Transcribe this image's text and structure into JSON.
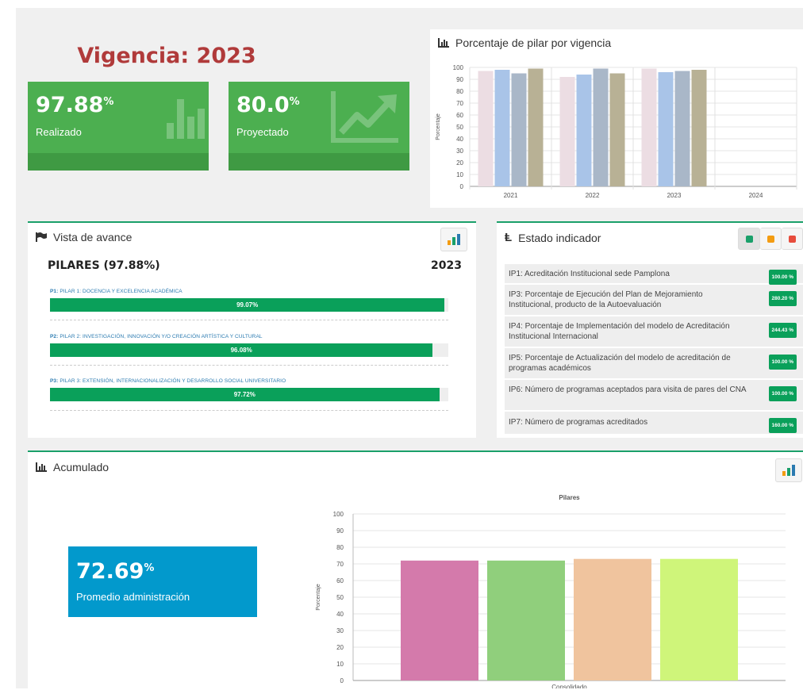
{
  "vigencia_title": "Vigencia: 2023",
  "kpis": [
    {
      "value": "97.88",
      "unit": "%",
      "label": "Realizado",
      "icon": "bar-chart-icon"
    },
    {
      "value": "80.0",
      "unit": "%",
      "label": "Proyectado",
      "icon": "trend-up-icon"
    }
  ],
  "pilar_chart": {
    "title": "Porcentaje de pilar por vigencia",
    "chart_data": {
      "type": "bar",
      "categories": [
        "2021",
        "2022",
        "2023",
        "2024"
      ],
      "series": [
        {
          "values": [
            97,
            92,
            99,
            null
          ],
          "color": "#ecdde3"
        },
        {
          "values": [
            98,
            94,
            96,
            null
          ],
          "color": "#a9c4e8"
        },
        {
          "values": [
            95,
            99,
            97,
            null
          ],
          "color": "#a9b7c8"
        },
        {
          "values": [
            99,
            95,
            98,
            null
          ],
          "color": "#b8b195"
        }
      ],
      "ylabel": "Porcentaje",
      "ylim": [
        0,
        100
      ],
      "yticks": [
        "0",
        "10",
        "20",
        "30",
        "40",
        "50",
        "60",
        "70",
        "80",
        "90",
        "100"
      ],
      "grid": true
    }
  },
  "avance": {
    "title": "Vista de avance",
    "pilares_header": "PILARES (97.88%)",
    "year": "2023",
    "pillars": [
      {
        "code": "P1:",
        "name": "PILAR 1: DOCENCIA Y EXCELENCIA ACADÉMICA",
        "value": 99.07,
        "value_label": "99.07%"
      },
      {
        "code": "P2:",
        "name": "PILAR 2: INVESTIGACIÓN, INNOVACIÓN Y/O CREACIÓN ARTÍSTICA Y CULTURAL",
        "value": 96.08,
        "value_label": "96.08%"
      },
      {
        "code": "P3:",
        "name": "PILAR 3: EXTENSIÓN, INTERNACIONALIZACIÓN Y DESARROLLO SOCIAL UNIVERSITARIO",
        "value": 97.72,
        "value_label": "97.72%"
      }
    ]
  },
  "estado": {
    "title": "Estado indicador",
    "filters": [
      {
        "name": "green",
        "color": "#1aa06a"
      },
      {
        "name": "orange",
        "color": "#f39c12"
      },
      {
        "name": "red",
        "color": "#e74c3c"
      }
    ],
    "indicators": [
      {
        "text": "IP1: Acreditación Institucional sede Pamplona",
        "badge": "100.00 %"
      },
      {
        "text": "IP3: Porcentaje de Ejecución del Plan de Mejoramiento Institucional, producto de la Autoevaluación",
        "badge": "280.20 %"
      },
      {
        "text": "IP4: Porcentaje de Implementación del modelo de Acreditación Institucional Internacional",
        "badge": "244.43 %"
      },
      {
        "text": "IP5: Porcentaje de Actualización del modelo de acreditación de programas académicos",
        "badge": "100.00 %"
      },
      {
        "text": "IP6: Número de programas aceptados para visita de pares del CNA",
        "badge": "100.00 %"
      },
      {
        "text": "IP7: Número de programas acreditados",
        "badge": "160.00 %"
      }
    ]
  },
  "acumulado": {
    "title": "Acumulado",
    "promedio": {
      "value": "72.69",
      "unit": "%",
      "label": "Promedio administración"
    },
    "chart_data": {
      "type": "bar",
      "title": "Pilares",
      "xlabel": "Consolidado",
      "ylabel": "Porcentaje",
      "ylim": [
        0,
        100
      ],
      "yticks": [
        "0",
        "10",
        "20",
        "30",
        "40",
        "50",
        "60",
        "70",
        "80",
        "90",
        "100"
      ],
      "series": [
        {
          "values": [
            72
          ],
          "color": "#d47aab"
        },
        {
          "values": [
            72
          ],
          "color": "#90cf7c"
        },
        {
          "values": [
            73
          ],
          "color": "#f0c49e"
        },
        {
          "values": [
            73
          ],
          "color": "#cff57a"
        }
      ]
    }
  }
}
